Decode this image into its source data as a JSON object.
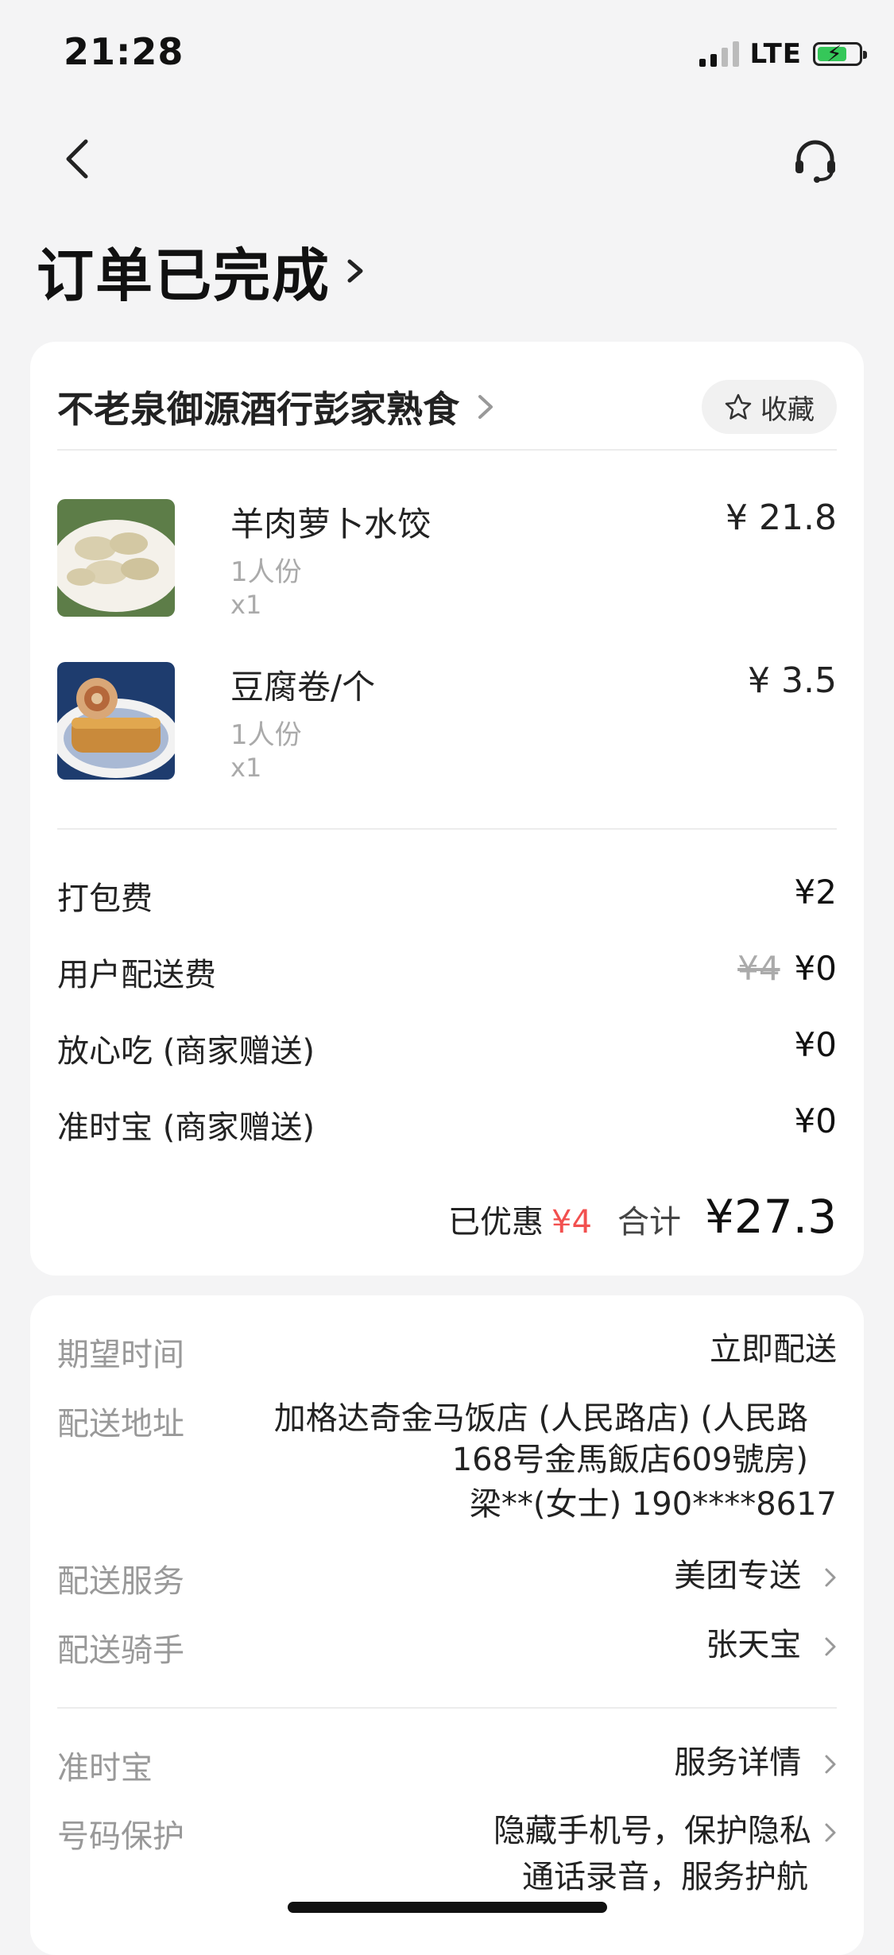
{
  "status_bar": {
    "time": "21:28",
    "network": "LTE"
  },
  "page": {
    "title": "订单已完成"
  },
  "shop": {
    "name": "不老泉御源酒行彭家熟食",
    "favorite_label": "收藏"
  },
  "items": [
    {
      "name": "羊肉萝卜水饺",
      "spec": "1人份",
      "qty": "x1",
      "price": "¥ 21.8"
    },
    {
      "name": "豆腐卷/个",
      "spec": "1人份",
      "qty": "x1",
      "price": "¥ 3.5"
    }
  ],
  "fees": [
    {
      "label": "打包费",
      "value": "¥2"
    },
    {
      "label": "用户配送费",
      "original": "¥4",
      "value": "¥0"
    },
    {
      "label": "放心吃 (商家赠送)",
      "value": "¥0"
    },
    {
      "label": "准时宝 (商家赠送)",
      "value": "¥0"
    }
  ],
  "summary": {
    "saved_label": "已优惠",
    "saved_value": "¥4",
    "total_label": "合计",
    "total_value": "¥27.3"
  },
  "delivery": {
    "expected_time": {
      "label": "期望时间",
      "value": "立即配送"
    },
    "address": {
      "label": "配送地址",
      "line1": "加格达奇金马饭店 (人民路店) (人民路",
      "line2": "168号金馬飯店609號房)",
      "contact": "梁**(女士) 190****8617"
    },
    "service": {
      "label": "配送服务",
      "value": "美团专送"
    },
    "rider": {
      "label": "配送骑手",
      "value": "张天宝"
    },
    "ontime": {
      "label": "准时宝",
      "value": "服务详情"
    },
    "privacy": {
      "label": "号码保护",
      "line1": "隐藏手机号，保护隐私",
      "line2": "通话录音，服务护航"
    }
  },
  "colors": {
    "accent_red": "#f2504f",
    "background": "#f4f4f5",
    "battery": "#35c759"
  }
}
